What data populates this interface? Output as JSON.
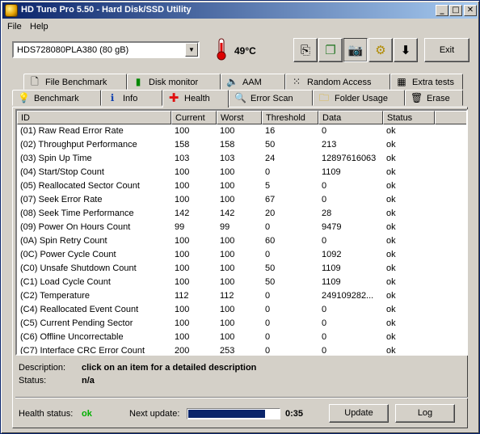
{
  "window": {
    "title": "HD Tune Pro 5.50 - Hard Disk/SSD Utility"
  },
  "window_controls": {
    "minimize": "_",
    "maximize": "□",
    "close": "✕"
  },
  "menu": [
    {
      "label": "File"
    },
    {
      "label": "Help"
    }
  ],
  "toolbar": {
    "drive": "HDS728080PLA380 (80 gB)",
    "temperature": "49",
    "temperature_unit": "°C",
    "exit_label": "Exit",
    "icons": [
      "copy-text-icon",
      "copy-info-icon",
      "screenshot-camera-icon",
      "options-icon",
      "save-down-arrow-icon"
    ]
  },
  "tabs": {
    "top": [
      {
        "label": "File Benchmark",
        "icon": "file-icon"
      },
      {
        "label": "Disk monitor",
        "icon": "chart-icon"
      },
      {
        "label": "AAM",
        "icon": "speaker-icon"
      },
      {
        "label": "Random Access",
        "icon": "dots-icon"
      },
      {
        "label": "Extra tests",
        "icon": "grid-icon"
      }
    ],
    "bottom": [
      {
        "label": "Benchmark",
        "icon": "bulb-icon"
      },
      {
        "label": "Info",
        "icon": "info-icon"
      },
      {
        "label": "Health",
        "icon": "health-cross-icon",
        "active": true
      },
      {
        "label": "Error Scan",
        "icon": "magnifier-icon"
      },
      {
        "label": "Folder Usage",
        "icon": "folder-icon"
      },
      {
        "label": "Erase",
        "icon": "trash-icon"
      }
    ]
  },
  "table": {
    "columns": [
      "ID",
      "Current",
      "Worst",
      "Threshold",
      "Data",
      "Status"
    ],
    "rows": [
      [
        "(01) Raw Read Error Rate",
        "100",
        "100",
        "16",
        "0",
        "ok"
      ],
      [
        "(02) Throughput Performance",
        "158",
        "158",
        "50",
        "213",
        "ok"
      ],
      [
        "(03) Spin Up Time",
        "103",
        "103",
        "24",
        "12897616063",
        "ok"
      ],
      [
        "(04) Start/Stop Count",
        "100",
        "100",
        "0",
        "1109",
        "ok"
      ],
      [
        "(05) Reallocated Sector Count",
        "100",
        "100",
        "5",
        "0",
        "ok"
      ],
      [
        "(07) Seek Error Rate",
        "100",
        "100",
        "67",
        "0",
        "ok"
      ],
      [
        "(08) Seek Time Performance",
        "142",
        "142",
        "20",
        "28",
        "ok"
      ],
      [
        "(09) Power On Hours Count",
        "99",
        "99",
        "0",
        "9479",
        "ok"
      ],
      [
        "(0A) Spin Retry Count",
        "100",
        "100",
        "60",
        "0",
        "ok"
      ],
      [
        "(0C) Power Cycle Count",
        "100",
        "100",
        "0",
        "1092",
        "ok"
      ],
      [
        "(C0) Unsafe Shutdown Count",
        "100",
        "100",
        "50",
        "1109",
        "ok"
      ],
      [
        "(C1) Load Cycle Count",
        "100",
        "100",
        "50",
        "1109",
        "ok"
      ],
      [
        "(C2) Temperature",
        "112",
        "112",
        "0",
        "249109282...",
        "ok"
      ],
      [
        "(C4) Reallocated Event Count",
        "100",
        "100",
        "0",
        "0",
        "ok"
      ],
      [
        "(C5) Current Pending Sector",
        "100",
        "100",
        "0",
        "0",
        "ok"
      ],
      [
        "(C6) Offline Uncorrectable",
        "100",
        "100",
        "0",
        "0",
        "ok"
      ],
      [
        "(C7) Interface CRC Error Count",
        "200",
        "253",
        "0",
        "0",
        "ok"
      ]
    ]
  },
  "description": {
    "desc_label": "Description:",
    "desc_value": "click on an item for a detailed description",
    "status_label": "Status:",
    "status_value": "n/a"
  },
  "footer": {
    "health_label": "Health status:",
    "health_value": "ok",
    "health_color": "#00b000",
    "next_update_label": "Next update:",
    "next_update_time": "0:35",
    "next_update_progress": 0.85,
    "update_label": "Update",
    "log_label": "Log"
  }
}
